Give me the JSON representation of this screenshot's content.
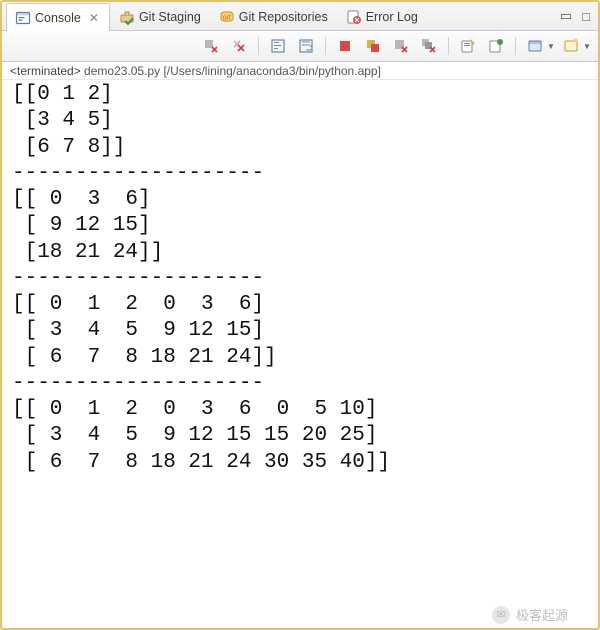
{
  "tabs": [
    {
      "label": "Console",
      "icon": "console",
      "close": true,
      "active": true
    },
    {
      "label": "Git Staging",
      "icon": "git-staging",
      "close": false,
      "active": false
    },
    {
      "label": "Git Repositories",
      "icon": "git-repos",
      "close": false,
      "active": false
    },
    {
      "label": "Error Log",
      "icon": "error-log",
      "close": false,
      "active": false
    }
  ],
  "window_buttons": {
    "minimize": "▭",
    "maximize": "□"
  },
  "toolbar_icons": [
    "terminate-remove",
    "remove-all",
    "scroll-lock",
    "word-wrap",
    "sep",
    "terminate",
    "terminate-all",
    "remove-launch",
    "remove-all-launch",
    "sep",
    "clear-console",
    "pin-console",
    "sep",
    "open-console",
    "new-console"
  ],
  "status": {
    "state": "<terminated>",
    "rest": " demo23.05.py [/Users/lining/anaconda3/bin/python.app]"
  },
  "console_output": "[[0 1 2]\n [3 4 5]\n [6 7 8]]\n--------------------\n[[ 0  3  6]\n [ 9 12 15]\n [18 21 24]]\n--------------------\n[[ 0  1  2  0  3  6]\n [ 3  4  5  9 12 15]\n [ 6  7  8 18 21 24]]\n--------------------\n[[ 0  1  2  0  3  6  0  5 10]\n [ 3  4  5  9 12 15 15 20 25]\n [ 6  7  8 18 21 24 30 35 40]]",
  "watermark": {
    "label": "极客起源"
  }
}
